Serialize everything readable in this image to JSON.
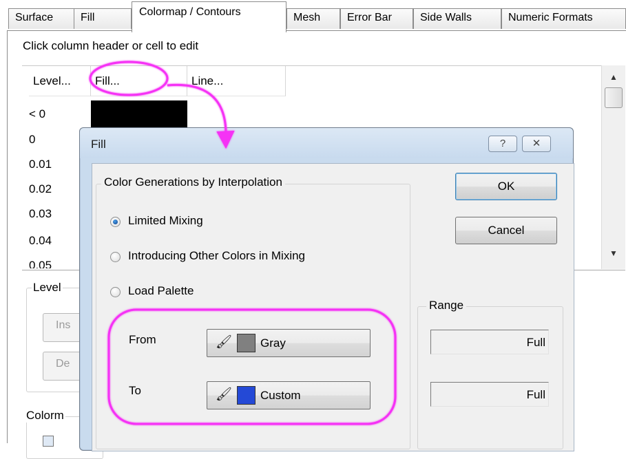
{
  "tabs": [
    {
      "label": "Surface"
    },
    {
      "label": "Fill"
    },
    {
      "label": "Colormap / Contours"
    },
    {
      "label": "Mesh"
    },
    {
      "label": "Error Bar"
    },
    {
      "label": "Side Walls"
    },
    {
      "label": "Numeric Formats"
    }
  ],
  "hint": "Click column header or cell to edit",
  "grid": {
    "columns": [
      "Level...",
      "Fill...",
      "Line..."
    ],
    "levels": [
      "< 0",
      "0",
      "0.01",
      "0.02",
      "0.03",
      "0.04",
      "0.05"
    ]
  },
  "background_groups": {
    "level_label": "Level",
    "insert_partial": "Ins",
    "delete_partial": "De",
    "colormap_label": "Colorm"
  },
  "dialog": {
    "title": "Fill",
    "help_glyph": "?",
    "close_glyph": "✕",
    "group_title": "Color Generations by Interpolation",
    "options": [
      "Limited Mixing",
      "Introducing Other Colors in Mixing",
      "Load Palette"
    ],
    "selected_option": "Limited Mixing",
    "ok_label": "OK",
    "cancel_label": "Cancel",
    "from_label": "From",
    "to_label": "To",
    "from_color": {
      "name": "Gray",
      "hex": "#808080"
    },
    "to_color": {
      "name": "Custom",
      "hex": "#2449d6"
    },
    "range_label": "Range",
    "range_values": [
      "Full",
      "Full"
    ]
  },
  "annotation_color": "#f531f5"
}
